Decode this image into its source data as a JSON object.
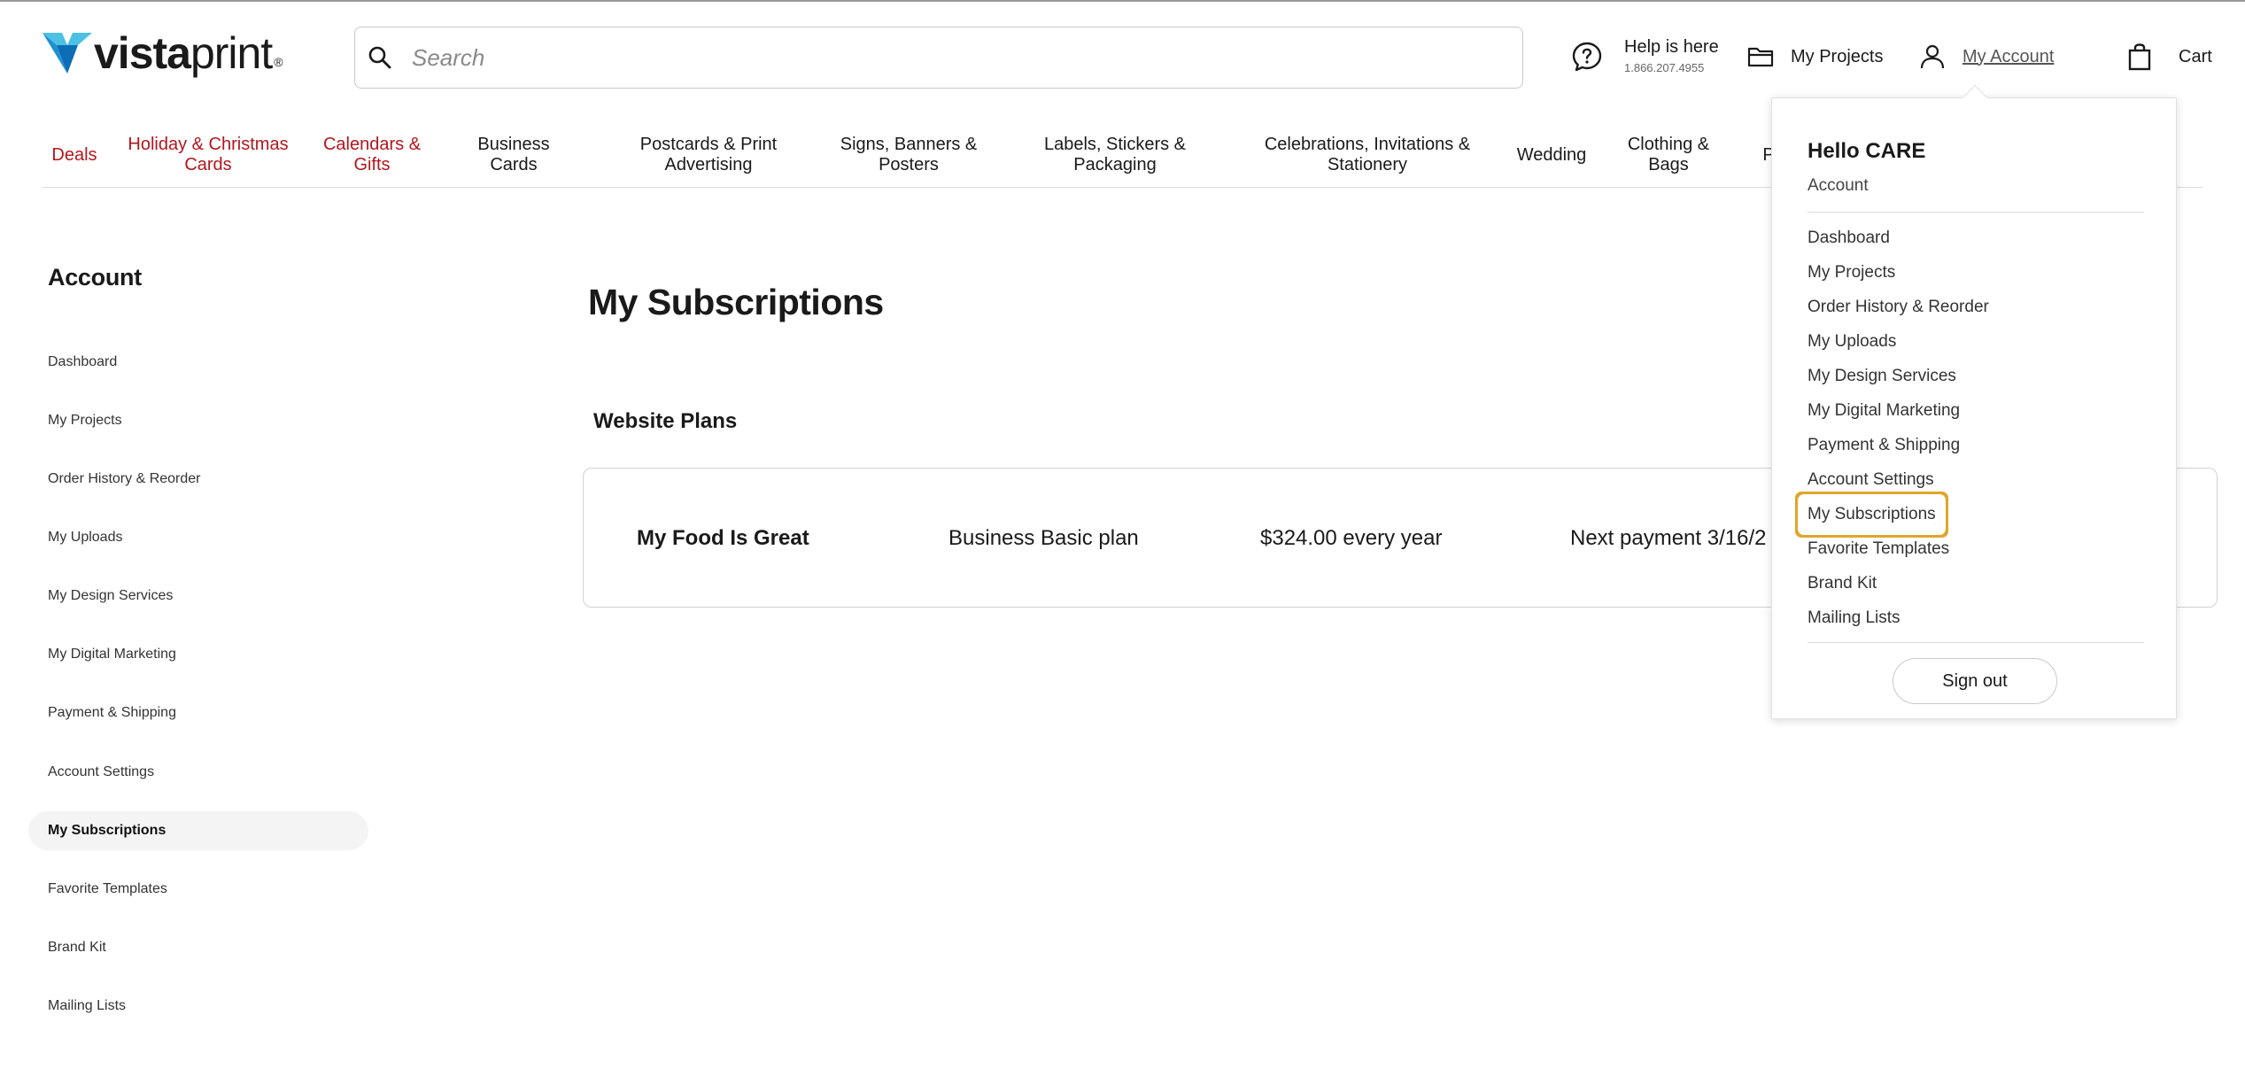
{
  "header": {
    "logo": {
      "brand_bold": "vista",
      "brand_light": "print",
      "registered": "®"
    },
    "search": {
      "placeholder": "Search"
    },
    "help": {
      "title": "Help is here",
      "phone": "1.866.207.4955"
    },
    "my_projects": "My Projects",
    "my_account": "My Account",
    "cart": "Cart"
  },
  "nav": [
    {
      "label": "Deals",
      "highlight": true
    },
    {
      "label": "Holiday & Christmas Cards",
      "highlight": true
    },
    {
      "label": "Calendars & Gifts",
      "highlight": true
    },
    {
      "label": "Business Cards",
      "highlight": false
    },
    {
      "label": "Postcards & Print Advertising",
      "highlight": false
    },
    {
      "label": "Signs, Banners & Posters",
      "highlight": false
    },
    {
      "label": "Labels, Stickers & Packaging",
      "highlight": false
    },
    {
      "label": "Celebrations, Invitations & Stationery",
      "highlight": false
    },
    {
      "label": "Wedding",
      "highlight": false
    },
    {
      "label": "Clothing & Bags",
      "highlight": false
    },
    {
      "label": "P",
      "highlight": false
    }
  ],
  "sidebar": {
    "title": "Account",
    "items": [
      {
        "label": "Dashboard",
        "active": false
      },
      {
        "label": "My Projects",
        "active": false
      },
      {
        "label": "Order History & Reorder",
        "active": false
      },
      {
        "label": "My Uploads",
        "active": false
      },
      {
        "label": "My Design Services",
        "active": false
      },
      {
        "label": "My Digital Marketing",
        "active": false
      },
      {
        "label": "Payment & Shipping",
        "active": false
      },
      {
        "label": "Account Settings",
        "active": false
      },
      {
        "label": "My Subscriptions",
        "active": true
      },
      {
        "label": "Favorite Templates",
        "active": false
      },
      {
        "label": "Brand Kit",
        "active": false
      },
      {
        "label": "Mailing Lists",
        "active": false
      }
    ]
  },
  "main": {
    "title": "My Subscriptions",
    "section": "Website Plans",
    "subscription": {
      "name": "My Food Is Great",
      "plan": "Business Basic plan",
      "price": "$324.00 every year",
      "next_payment": "Next payment 3/16/2"
    }
  },
  "dropdown": {
    "greeting": "Hello CARE",
    "account_link": "Account",
    "items": [
      {
        "label": "Dashboard"
      },
      {
        "label": "My Projects"
      },
      {
        "label": "Order History & Reorder"
      },
      {
        "label": "My Uploads"
      },
      {
        "label": "My Design Services"
      },
      {
        "label": "My Digital Marketing"
      },
      {
        "label": "Payment & Shipping"
      },
      {
        "label": "Account Settings"
      },
      {
        "label": "My Subscriptions",
        "highlighted": true
      },
      {
        "label": "Favorite Templates"
      },
      {
        "label": "Brand Kit"
      },
      {
        "label": "Mailing Lists"
      }
    ],
    "sign_out": "Sign out"
  },
  "colors": {
    "deal_red": "#b3161d",
    "logo_blue": "#0d6db5",
    "logo_light_blue": "#4cc1e4",
    "highlight_outline": "#e0a52a"
  }
}
